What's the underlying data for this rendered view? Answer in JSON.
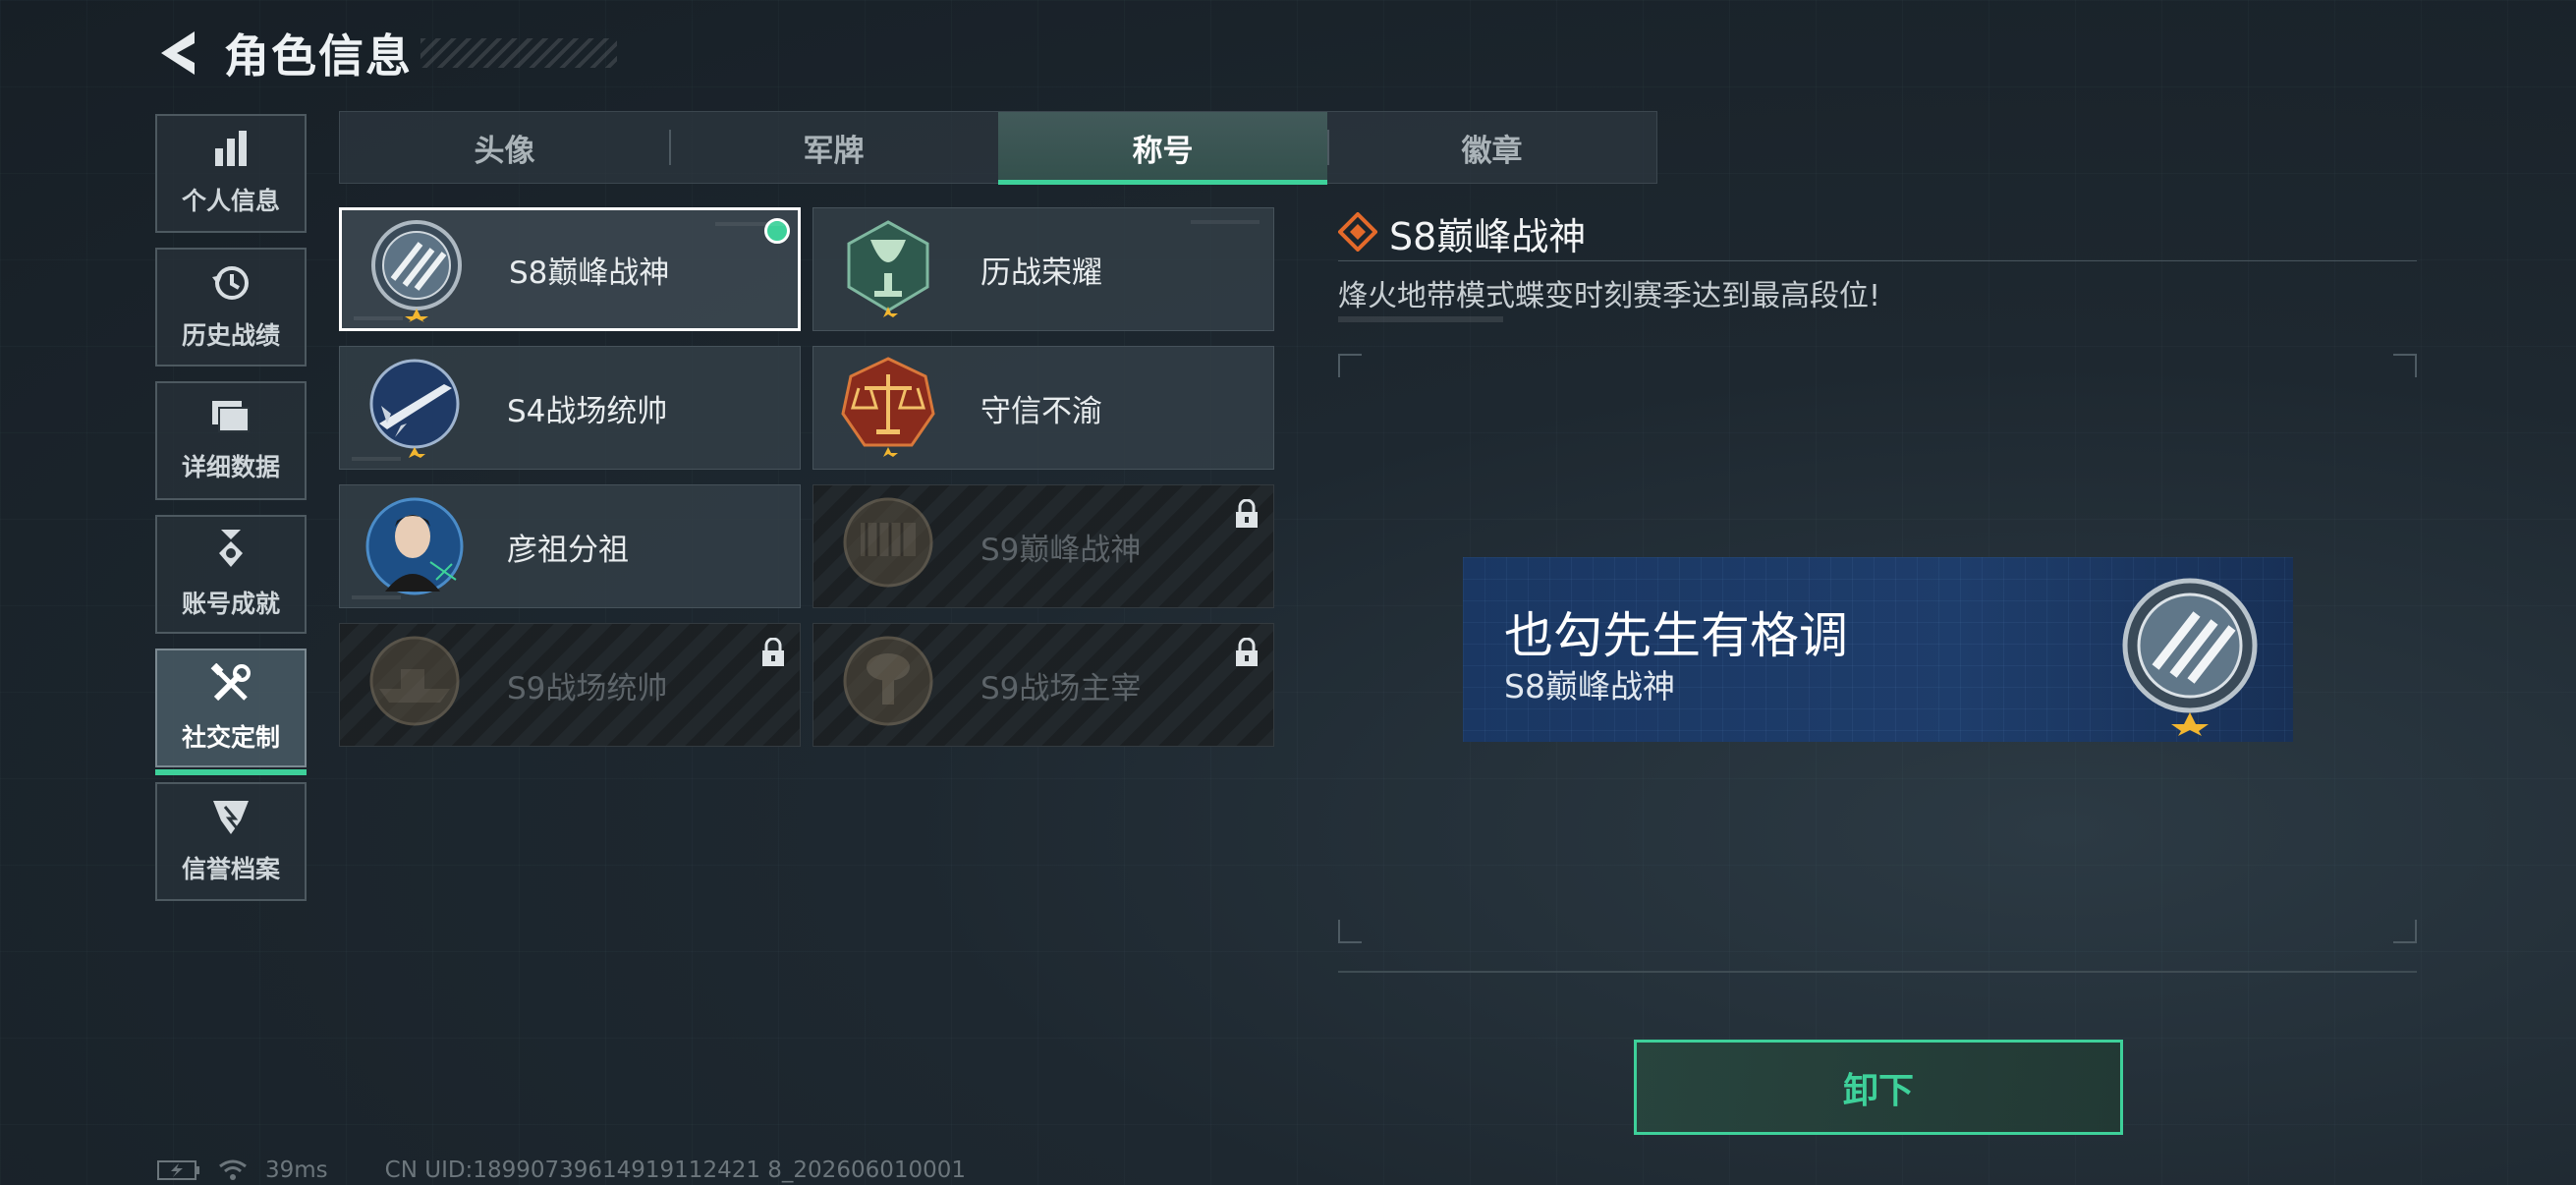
{
  "header": {
    "title": "角色信息"
  },
  "sidebar": {
    "items": [
      {
        "label": "个人信息",
        "icon": "bar-chart-icon"
      },
      {
        "label": "历史战绩",
        "icon": "history-clock-icon"
      },
      {
        "label": "详细数据",
        "icon": "folders-icon"
      },
      {
        "label": "账号成就",
        "icon": "medal-icon"
      },
      {
        "label": "社交定制",
        "icon": "tools-icon",
        "active": true
      },
      {
        "label": "信誉档案",
        "icon": "reputation-icon"
      }
    ]
  },
  "tabs": [
    {
      "label": "头像"
    },
    {
      "label": "军牌"
    },
    {
      "label": "称号",
      "active": true
    },
    {
      "label": "徽章"
    }
  ],
  "cards": [
    {
      "name": "S8巅峰战神",
      "state": "equipped",
      "emblem": "s8-peak-emblem-icon"
    },
    {
      "name": "历战荣耀",
      "state": "owned",
      "emblem": "trophy-emblem-icon"
    },
    {
      "name": "S4战场统帅",
      "state": "owned",
      "emblem": "missile-emblem-icon"
    },
    {
      "name": "守信不渝",
      "state": "owned",
      "emblem": "scales-emblem-icon"
    },
    {
      "name": "彦祖分祖",
      "state": "owned",
      "emblem": "portrait-emblem-icon"
    },
    {
      "name": "S9巅峰战神",
      "state": "locked",
      "emblem": "s9-dam-emblem-icon"
    },
    {
      "name": "S9战场统帅",
      "state": "locked",
      "emblem": "s9-ship-emblem-icon"
    },
    {
      "name": "S9战场主宰",
      "state": "locked",
      "emblem": "s9-explosion-emblem-icon"
    }
  ],
  "detail": {
    "title": "S8巅峰战神",
    "description": "烽火地带模式蝶变时刻赛季达到最高段位!",
    "banner": {
      "player_name": "也勾先生有格调",
      "title": "S8巅峰战神"
    },
    "action_label": "卸下"
  },
  "status_bar": {
    "ping": "39ms",
    "uid": "CN UID:18990739614919112421 8_202606010001"
  },
  "colors": {
    "accent": "#3ed19a",
    "highlight": "#e46a2a"
  }
}
